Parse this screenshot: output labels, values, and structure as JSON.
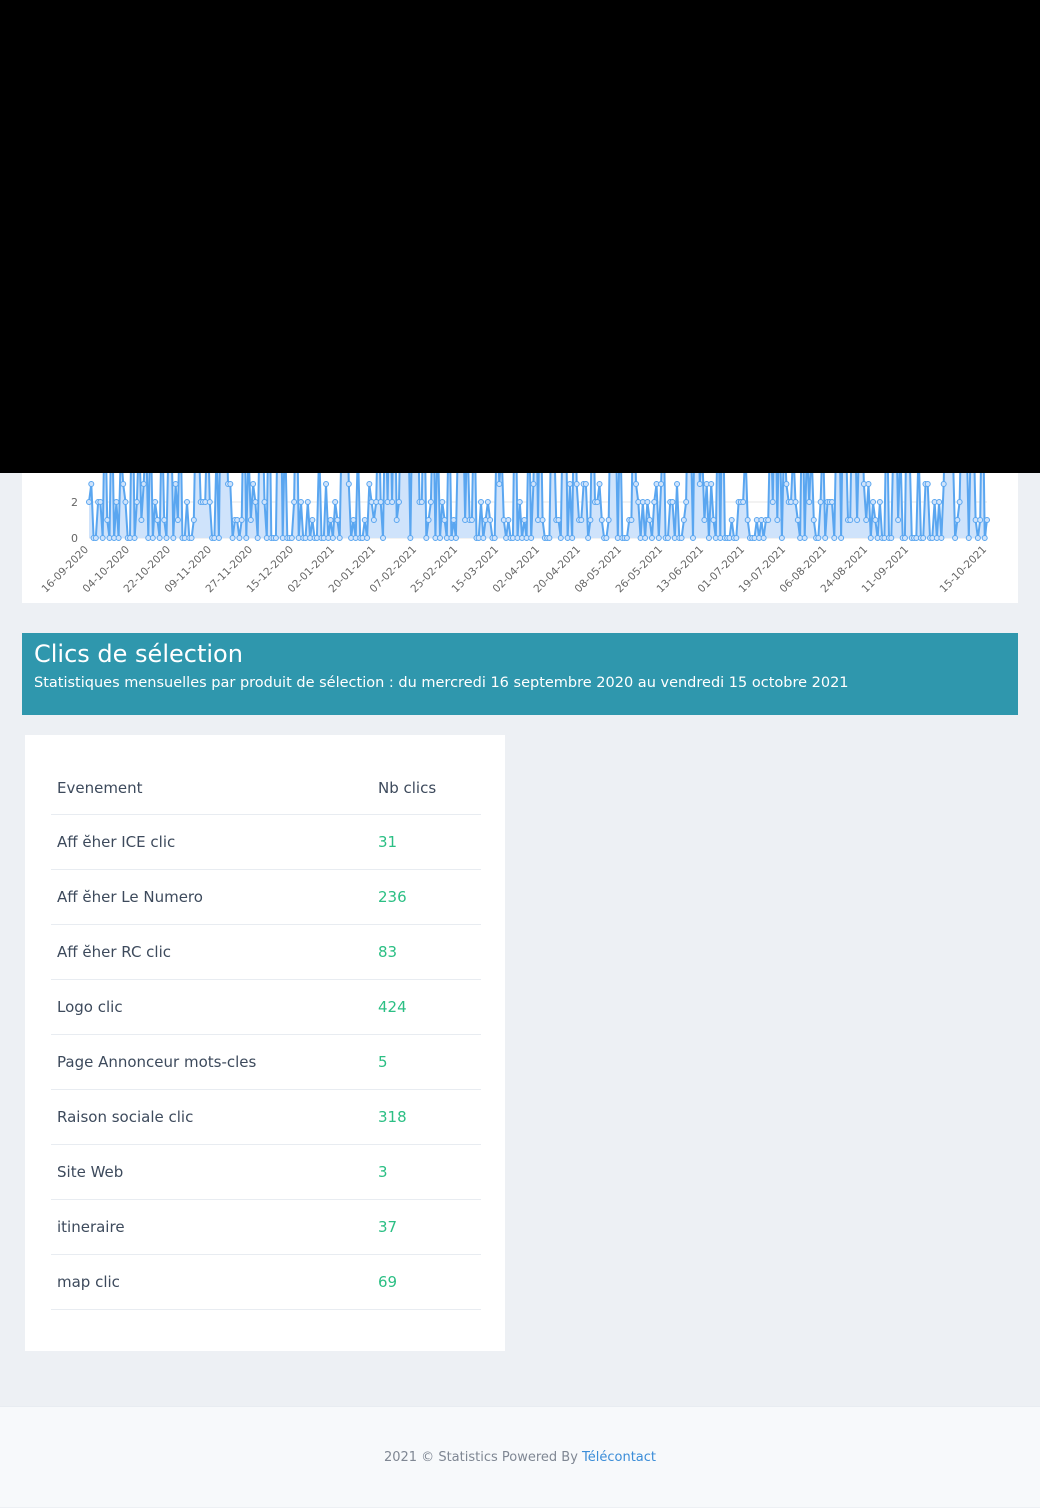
{
  "chart_data": {
    "type": "line",
    "ytick_labels": [
      "0",
      "2"
    ],
    "x_tick_labels": [
      "16-09-2020",
      "04-10-2020",
      "22-10-2020",
      "09-11-2020",
      "27-11-2020",
      "15-12-2020",
      "02-01-2021",
      "20-01-2021",
      "07-02-2021",
      "25-02-2021",
      "15-03-2021",
      "02-04-2021",
      "20-04-2021",
      "08-05-2021",
      "26-05-2021",
      "13-06-2021",
      "01-07-2021",
      "19-07-2021",
      "06-08-2021",
      "24-08-2021",
      "11-09-2021",
      "15-10-2021"
    ],
    "xlabel": "",
    "ylabel": "",
    "series_color": "#5aa6f0",
    "fill_color": "#cfe3fb",
    "grid": true
  },
  "section": {
    "title": "Clics de sélection",
    "subtitle": "Statistiques mensuelles par produit de sélection : du mercredi 16 septembre 2020 au vendredi 15 octobre 2021"
  },
  "table": {
    "headers": [
      "Evenement",
      "Nb clics"
    ],
    "rows": [
      {
        "event": "Aff ӗher ICE clic",
        "clicks": "31"
      },
      {
        "event": "Aff ӗher Le Numero",
        "clicks": "236"
      },
      {
        "event": "Aff ӗher RC clic",
        "clicks": "83"
      },
      {
        "event": "Logo clic",
        "clicks": "424"
      },
      {
        "event": "Page Annonceur mots-cles",
        "clicks": "5"
      },
      {
        "event": "Raison sociale clic",
        "clicks": "318"
      },
      {
        "event": "Site Web",
        "clicks": "3"
      },
      {
        "event": "itineraire",
        "clicks": "37"
      },
      {
        "event": "map clic",
        "clicks": "69"
      }
    ]
  },
  "footer": {
    "text": "2021 © Statistics Powered By",
    "link_label": "Télécontact"
  }
}
